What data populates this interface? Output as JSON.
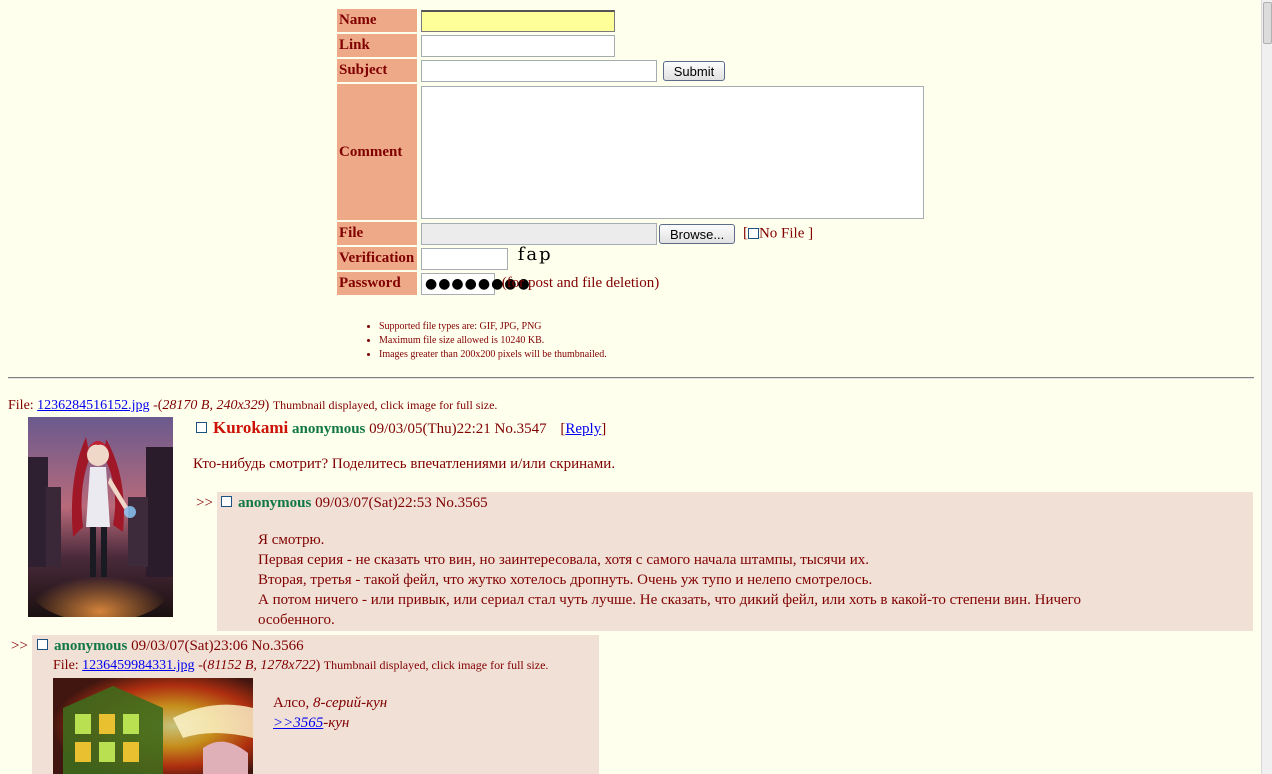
{
  "form": {
    "name_label": "Name",
    "link_label": "Link",
    "subject_label": "Subject",
    "submit_label": "Submit",
    "comment_label": "Comment",
    "file_label": "File",
    "browse_label": "Browse...",
    "nofile_open": "[",
    "nofile_label": "No File ]",
    "verification_label": "Verification",
    "captcha_text": "fap",
    "password_label": "Password",
    "password_value": "●●●●●●●●",
    "password_note": "(for post and file deletion)"
  },
  "rules": [
    "Supported file types are: GIF, JPG, PNG",
    "Maximum file size allowed is 10240 KB.",
    "Images greater than 200x200 pixels will be thumbnailed."
  ],
  "thread": {
    "op": {
      "file_prefix": "File:",
      "file_name": "1236284516152.jpg",
      "file_details_pre": "-(",
      "file_details": "28170 B, 240x329",
      "file_details_post": ")",
      "thumb_note": "Thumbnail displayed, click image for full size.",
      "subject": "Kurokami",
      "name": "anonymous",
      "date": "09/03/05(Thu)22:21",
      "number": "No.3547",
      "reply_open": "[",
      "reply_label": "Reply",
      "reply_close": "]",
      "message": "Кто-нибудь смотрит? Поделитесь впечатлениями и/или скринами."
    },
    "replies": [
      {
        "marker": ">>",
        "name": "anonymous",
        "date": "09/03/07(Sat)22:53",
        "number": "No.3565",
        "lines": [
          "Я смотрю.",
          "Первая серия - не сказать что вин, но заинтересовала, хотя с самого начала штампы, тысячи их.",
          "Вторая, третья - такой фейл, что жутко хотелось дропнуть. Очень уж тупо и нелепо смотрелось.",
          "А потом ничего - или привык, или сериал стал чуть лучше. Не сказать, что дикий фейл, или хоть в какой-то степени вин. Ничего",
          "особенного."
        ]
      },
      {
        "marker": ">>",
        "name": "anonymous",
        "date": "09/03/07(Sat)23:06",
        "number": "No.3566",
        "file_prefix": "File:",
        "file_name": "1236459984331.jpg",
        "file_details_pre": "-(",
        "file_details": "81152 B, 1278x722",
        "file_details_post": ")",
        "thumb_note": "Thumbnail displayed, click image for full size.",
        "line1_plain": "Алсо,",
        "line1_italic": "8-серий-кун",
        "line2_link": ">>3565",
        "line2_italic": "-кун"
      }
    ]
  }
}
